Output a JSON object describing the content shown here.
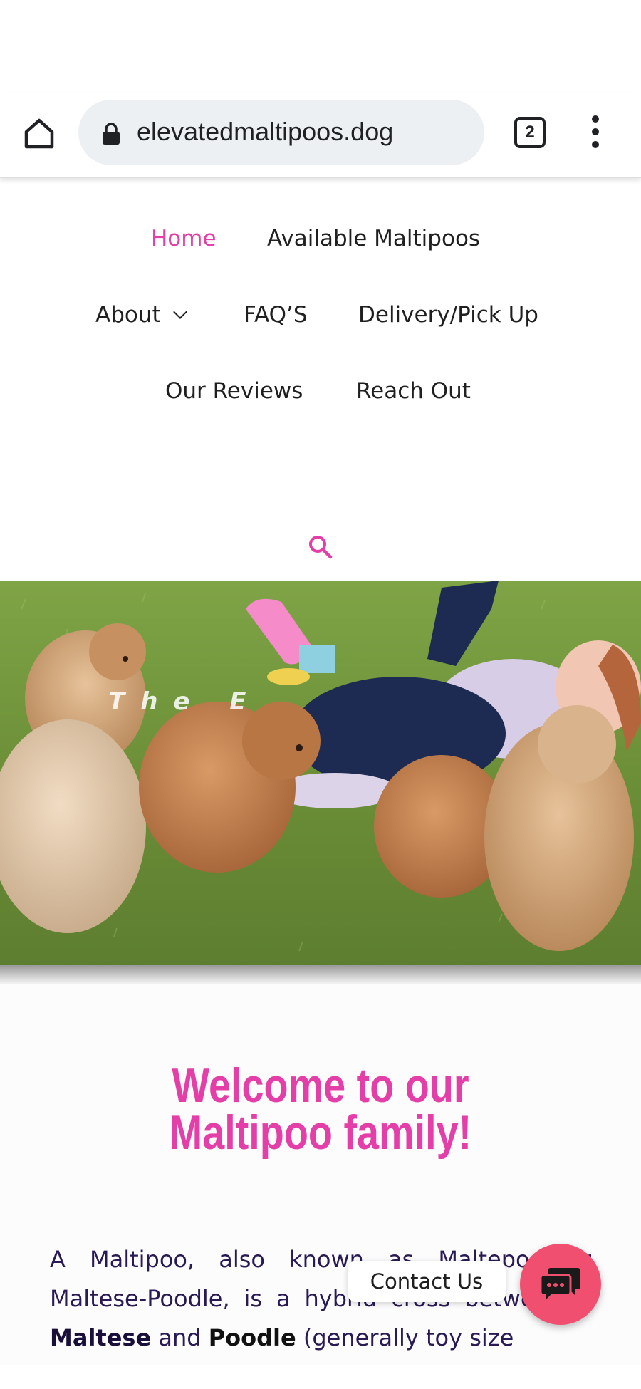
{
  "browser": {
    "url": "elevatedmaltipoos.dog",
    "tab_count": "2"
  },
  "nav": {
    "items": [
      {
        "label": "Home"
      },
      {
        "label": "Available Maltipoos"
      },
      {
        "label": "About"
      },
      {
        "label": "FAQ’S"
      },
      {
        "label": "Delivery/Pick Up"
      },
      {
        "label": "Our Reviews"
      },
      {
        "label": "Reach Out"
      }
    ]
  },
  "hero": {
    "overlay_text": "The E"
  },
  "content": {
    "headline": "Welcome to our Maltipoo family!",
    "paragraph": {
      "part1": "A Maltipoo, also known as Maltepoo or Maltese-Poodle, is a hybrid cross between a ",
      "maltese": "Maltese",
      "and": " and ",
      "poodle": "Poodle",
      "part2": " (generally toy size"
    }
  },
  "contact": {
    "label": "Contact Us"
  },
  "colors": {
    "accent_pink": "#e43fa8",
    "chat_button": "#f04f6f",
    "url_bar": "#edf0f2",
    "body_text": "#2a1a54"
  },
  "icons": {
    "home": "home-icon",
    "lock": "lock-icon",
    "menu": "more-vert-icon",
    "search": "search-icon",
    "chat": "chat-bubbles-icon",
    "chevron": "chevron-down-icon"
  }
}
